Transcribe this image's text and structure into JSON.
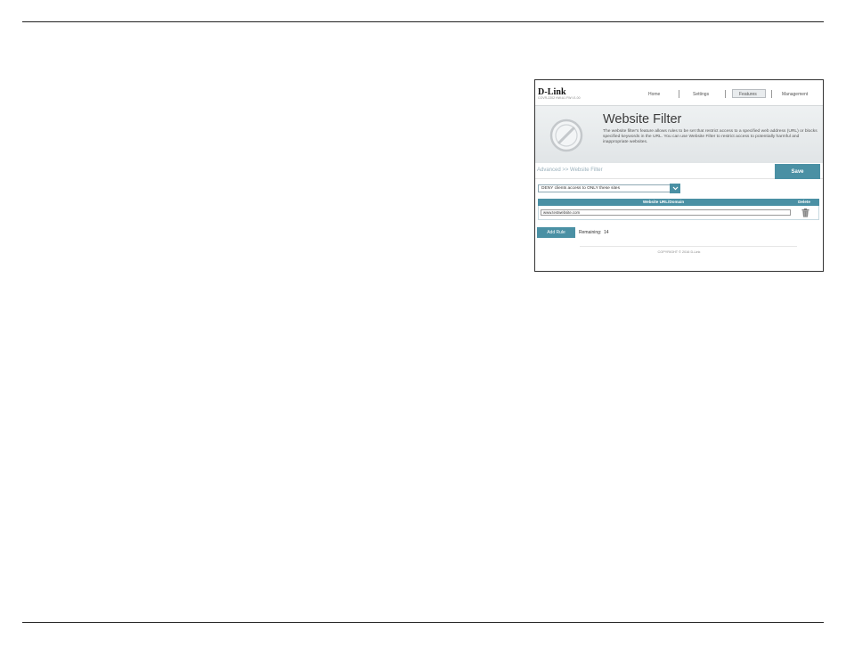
{
  "router": {
    "brand": "D-Link",
    "model": "COVR-2202 HW:A1 FW:V1.00",
    "nav": [
      {
        "label": "Home"
      },
      {
        "label": "Settings"
      },
      {
        "label": "Features",
        "active": true
      },
      {
        "label": "Management"
      }
    ],
    "hero": {
      "title": "Website Filter",
      "description": "The website filter's feature allows rules to be set that restrict access to a specified web address (URL) or blocks specified keywords in the URL. You can use Website Filter to restrict access to potentially harmful and inappropriate websites.",
      "icon": "no-entry-icon"
    },
    "breadcrumb": "Advanced >> Website Filter",
    "save_label": "Save",
    "filter_mode": {
      "selected": "DENY clients access to ONLY these sites",
      "icon": "chevron-down-icon"
    },
    "table": {
      "columns": [
        "Website URL/Domain",
        "Delete"
      ],
      "rows": [
        {
          "url": "www.testwebsite.com",
          "delete_icon": "trash-icon"
        }
      ]
    },
    "add_rule_label": "Add Rule",
    "remaining_label": "Remaining:",
    "remaining_value": "14",
    "copyright": "COPYRIGHT © 2016 D-Link"
  },
  "colors": {
    "accent": "#4a90a4",
    "hero_bg": "#e6eaec"
  }
}
